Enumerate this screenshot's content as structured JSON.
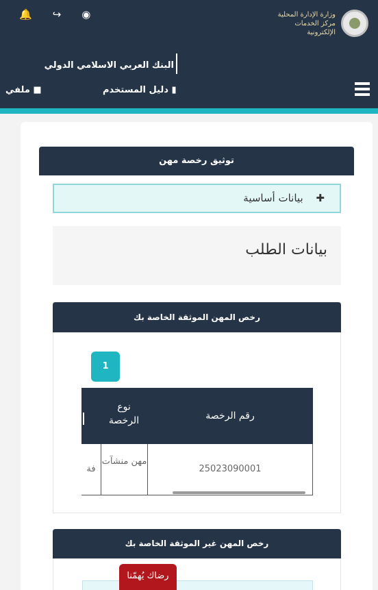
{
  "header": {
    "logo_text": "وزارة الإدارة المحلية\nمركز الخدمات الإلكترونية",
    "bank_name": "البنك العربي الاسلامي الدولي",
    "nav": {
      "guide": "دليل المستخدم",
      "profile": "ملفي"
    },
    "top_icons": [
      "bell-icon",
      "logout-icon",
      "globe-icon"
    ]
  },
  "main_panel": {
    "title": "توثيق رخصة مهن",
    "accordion_label": "بيانات أساسية",
    "request_title": "بيانات الطلب"
  },
  "documented_licenses": {
    "title": "رخص المهن الموثقة الخاصة بك",
    "page_badge": "1",
    "columns": [
      "رقم الرخصة",
      "نوع الرخصة",
      "ا"
    ],
    "rows": [
      {
        "license_number": "25023090001",
        "license_type": "مهن منشآت",
        "cut": "فة"
      }
    ]
  },
  "undocumented_licenses": {
    "title": "رخص المهن غير الموثقة الخاصة بك"
  },
  "satisfaction_button": "رضاك يُهمّنا",
  "colors": {
    "navy": "#253547",
    "teal": "#1fb6c1",
    "red": "#b1171c"
  }
}
